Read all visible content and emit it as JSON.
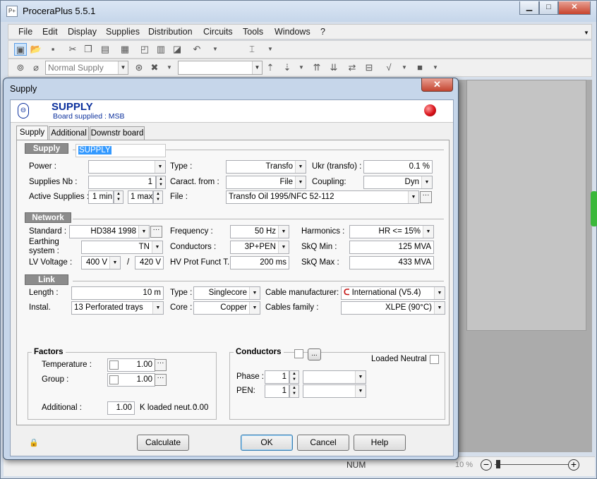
{
  "app": {
    "title": "ProceraPlus 5.5.1",
    "icon_text": "P+"
  },
  "window_buttons": {
    "minimize": "▁",
    "maximize": "□",
    "close": "✕"
  },
  "menu": [
    "File",
    "Edit",
    "Display",
    "Supplies",
    "Distribution",
    "Circuits",
    "Tools",
    "Windows",
    "?"
  ],
  "toolbar": {
    "supply_combo": "Normal Supply",
    "empty_combo": ""
  },
  "status": {
    "num": "NUM",
    "zoom": "10 %",
    "zoom_out": "−",
    "zoom_in": "+"
  },
  "dialog": {
    "title": "Supply",
    "close": "✕",
    "header": {
      "title": "SUPPLY",
      "subtitle": "Board supplied : MSB"
    },
    "tabs": [
      "Supply",
      "Additional",
      "Downstr board"
    ],
    "supply": {
      "section": "Supply",
      "name": "SUPPLY",
      "power_label": "Power :",
      "power_value": "",
      "supplies_nb_label": "Supplies Nb :",
      "supplies_nb_value": "1",
      "active_label": "Active Supplies :",
      "active_min": "1 min",
      "active_max": "1 max",
      "type_label": "Type :",
      "type_value": "Transfo",
      "caract_label": "Caract. from :",
      "caract_value": "File",
      "file_label": "File :",
      "file_value": "Transfo Oil 1995/NFC 52-112",
      "ukr_label": "Ukr (transfo) :",
      "ukr_value": "0.1 %",
      "coupling_label": "Coupling:",
      "coupling_value": "Dyn"
    },
    "network": {
      "section": "Network",
      "standard_label": "Standard :",
      "standard_value": "HD384 1998",
      "earthing_label1": "Earthing",
      "earthing_label2": "system :",
      "earthing_value": "TN",
      "lv_label": "LV Voltage :",
      "lv_value1": "400 V",
      "lv_sep": "/",
      "lv_value2": "420 V",
      "freq_label": "Frequency :",
      "freq_value": "50 Hz",
      "conductors_label": "Conductors :",
      "conductors_value": "3P+PEN",
      "hvprot_label": "HV Prot Funct T.:",
      "hvprot_value": "200 ms",
      "harmonics_label": "Harmonics :",
      "harmonics_value": "HR <= 15%",
      "skqmin_label": "SkQ Min :",
      "skqmin_value": "125 MVA",
      "skqmax_label": "SkQ Max :",
      "skqmax_value": "433 MVA"
    },
    "link": {
      "section": "Link",
      "length_label": "Length :",
      "length_value": "10 m",
      "instal_label": "Instal.",
      "instal_value": "13  Perforated trays",
      "type_label": "Type :",
      "type_value": "Singlecore",
      "core_label": "Core :",
      "core_value": "Copper",
      "manuf_label": "Cable manufacturer:",
      "manuf_value": "International (V5.4)",
      "family_label": "Cables family :",
      "family_value": "XLPE (90°C)"
    },
    "factors": {
      "title": "Factors",
      "temp_label": "Temperature :",
      "temp_value": "1.00",
      "group_label": "Group :",
      "group_value": "1.00",
      "additional_label": "Additional :",
      "additional_value": "1.00",
      "kloaded_label": "K loaded neut. :",
      "kloaded_value": "0.00"
    },
    "conductors": {
      "title": "Conductors",
      "dots": "...",
      "loaded_label": "Loaded Neutral :",
      "phase_label": "Phase :",
      "phase_value": "1",
      "pen_label": "PEN:",
      "pen_value": "1"
    },
    "buttons": {
      "calculate": "Calculate",
      "ok": "OK",
      "cancel": "Cancel",
      "help": "Help"
    },
    "lock_icon": "🔒"
  },
  "colors": {
    "accent": "#0a2f9c",
    "indicator": "#d9131b",
    "section_bg": "#8c8c8c"
  }
}
